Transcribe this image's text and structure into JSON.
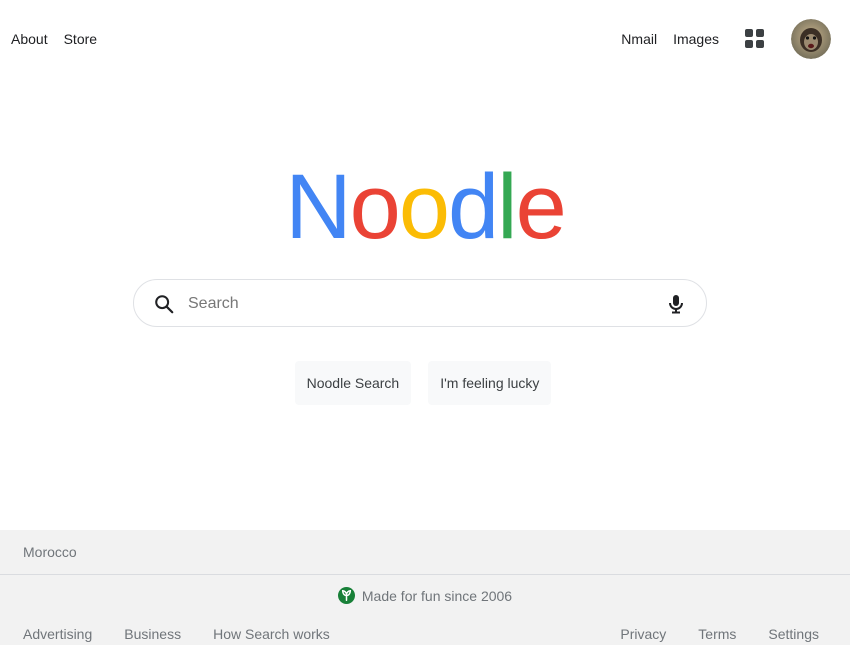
{
  "header": {
    "left_links": [
      {
        "label": "About"
      },
      {
        "label": "Store"
      }
    ],
    "right_links": [
      {
        "label": "Nmail"
      },
      {
        "label": "Images"
      }
    ],
    "apps_icon": "apps-grid-icon",
    "avatar_icon": "user-avatar"
  },
  "logo": {
    "letters": [
      {
        "char": "N",
        "color": "#4285f4"
      },
      {
        "char": "o",
        "color": "#ea4335"
      },
      {
        "char": "o",
        "color": "#fbbc05"
      },
      {
        "char": "d",
        "color": "#4285f4"
      },
      {
        "char": "l",
        "color": "#34a853"
      },
      {
        "char": "e",
        "color": "#ea4335"
      }
    ]
  },
  "search": {
    "placeholder": "Search",
    "value": "",
    "search_icon": "search-icon",
    "mic_icon": "microphone-icon"
  },
  "buttons": {
    "search_label": "Noodle Search",
    "lucky_label": "I'm feeling lucky"
  },
  "footer": {
    "country": "Morocco",
    "tagline": "Made for fun since 2006",
    "tagline_icon": "leaf-icon",
    "left_links": [
      {
        "label": "Advertising"
      },
      {
        "label": "Business"
      },
      {
        "label": "How Search works"
      }
    ],
    "right_links": [
      {
        "label": "Privacy"
      },
      {
        "label": "Terms"
      },
      {
        "label": "Settings"
      }
    ]
  }
}
